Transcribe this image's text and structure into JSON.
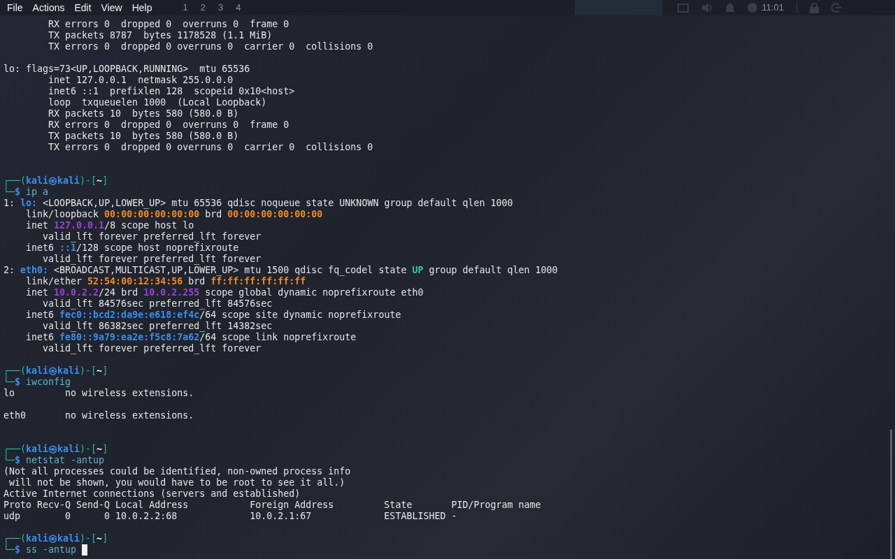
{
  "menu": [
    "File",
    "Actions",
    "Edit",
    "View",
    "Help"
  ],
  "panel": {
    "workspaces": [
      "1",
      "2",
      "3",
      "4"
    ],
    "clock": "11:01"
  },
  "terminal": {
    "blocks": [
      {
        "blank_after": true,
        "lines": [
          "        RX errors 0  dropped 0  overruns 0  frame 0",
          "        TX packets 8787  bytes 1178528 (1.1 MiB)",
          "        TX errors 0  dropped 0 overruns 0  carrier 0  collisions 0"
        ]
      },
      {
        "blank_after": true,
        "double_blank": true,
        "lines": [
          "lo: flags=73<UP,LOOPBACK,RUNNING>  mtu 65536",
          "        inet 127.0.0.1  netmask 255.0.0.0",
          "        inet6 ::1  prefixlen 128  scopeid 0x10<host>",
          "        loop  txqueuelen 1000  (Local Loopback)",
          "        RX packets 10  bytes 580 (580.0 B)",
          "        RX errors 0  dropped 0  overruns 0  frame 0",
          "        TX packets 10  bytes 580 (580.0 B)",
          "        TX errors 0  dropped 0 overruns 0  carrier 0  collisions 0"
        ]
      },
      {
        "blank_after": true,
        "lines": [
          [
            {
              "text": "┌──(",
              "kind": "frame"
            },
            {
              "text": "kali㉿kali",
              "kind": "user"
            },
            {
              "text": ")-[",
              "kind": "frame"
            },
            {
              "text": "~",
              "kind": "dir"
            },
            {
              "text": "]",
              "kind": "frame"
            }
          ],
          [
            {
              "text": "└─",
              "kind": "frame"
            },
            {
              "text": "$",
              "kind": "user"
            },
            {
              "text": " ip a",
              "kind": "cmd"
            }
          ],
          [
            {
              "text": "1: ",
              "kind": "plain"
            },
            {
              "text": "lo:",
              "kind": "iface"
            },
            {
              "text": " <LOOPBACK,UP,LOWER_UP> mtu 65536 qdisc noqueue state UNKNOWN group default qlen 1000",
              "kind": "plain"
            }
          ],
          [
            {
              "text": "    link/loopback ",
              "kind": "plain"
            },
            {
              "text": "00:00:00:00:00:00",
              "kind": "mac"
            },
            {
              "text": " brd ",
              "kind": "plain"
            },
            {
              "text": "00:00:00:00:00:00",
              "kind": "mac"
            }
          ],
          [
            {
              "text": "    inet ",
              "kind": "plain"
            },
            {
              "text": "127.0.0.1",
              "kind": "ip4"
            },
            {
              "text": "/8 scope host lo",
              "kind": "plain"
            }
          ],
          "       valid_lft forever preferred_lft forever",
          [
            {
              "text": "    inet6 ",
              "kind": "plain"
            },
            {
              "text": "::1",
              "kind": "ip6"
            },
            {
              "text": "/128 scope host noprefixroute",
              "kind": "plain"
            }
          ],
          "       valid_lft forever preferred_lft forever",
          [
            {
              "text": "2: ",
              "kind": "plain"
            },
            {
              "text": "eth0:",
              "kind": "iface"
            },
            {
              "text": " <BROADCAST,MULTICAST,UP,LOWER_UP> mtu 1500 qdisc fq_codel state ",
              "kind": "plain"
            },
            {
              "text": "UP",
              "kind": "up"
            },
            {
              "text": " group default qlen 1000",
              "kind": "plain"
            }
          ],
          [
            {
              "text": "    link/ether ",
              "kind": "plain"
            },
            {
              "text": "52:54:00:12:34:56",
              "kind": "mac"
            },
            {
              "text": " brd ",
              "kind": "plain"
            },
            {
              "text": "ff:ff:ff:ff:ff:ff",
              "kind": "mac"
            }
          ],
          [
            {
              "text": "    inet ",
              "kind": "plain"
            },
            {
              "text": "10.0.2.2",
              "kind": "ip4"
            },
            {
              "text": "/24 brd ",
              "kind": "plain"
            },
            {
              "text": "10.0.2.255",
              "kind": "ip4"
            },
            {
              "text": " scope global dynamic noprefixroute eth0",
              "kind": "plain"
            }
          ],
          "       valid_lft 84576sec preferred_lft 84576sec",
          [
            {
              "text": "    inet6 ",
              "kind": "plain"
            },
            {
              "text": "fec0::bcd2:da9e:e618:ef4c",
              "kind": "ip6"
            },
            {
              "text": "/64 scope site dynamic noprefixroute",
              "kind": "plain"
            }
          ],
          "       valid_lft 86382sec preferred_lft 14382sec",
          [
            {
              "text": "    inet6 ",
              "kind": "plain"
            },
            {
              "text": "fe80::9a79:ea2e:f5c8:7a62",
              "kind": "ip6"
            },
            {
              "text": "/64 scope link noprefixroute",
              "kind": "plain"
            }
          ],
          "       valid_lft forever preferred_lft forever"
        ]
      },
      {
        "blank_after": true,
        "lines": [
          [
            {
              "text": "┌──(",
              "kind": "frame"
            },
            {
              "text": "kali㉿kali",
              "kind": "user"
            },
            {
              "text": ")-[",
              "kind": "frame"
            },
            {
              "text": "~",
              "kind": "dir"
            },
            {
              "text": "]",
              "kind": "frame"
            }
          ],
          [
            {
              "text": "└─",
              "kind": "frame"
            },
            {
              "text": "$",
              "kind": "user"
            },
            {
              "text": " iwconfig",
              "kind": "cmd"
            }
          ],
          "lo         no wireless extensions."
        ]
      },
      {
        "blank_after": true,
        "double_blank": true,
        "lines": [
          "eth0       no wireless extensions."
        ]
      },
      {
        "blank_after": true,
        "lines": [
          [
            {
              "text": "┌──(",
              "kind": "frame"
            },
            {
              "text": "kali㉿kali",
              "kind": "user"
            },
            {
              "text": ")-[",
              "kind": "frame"
            },
            {
              "text": "~",
              "kind": "dir"
            },
            {
              "text": "]",
              "kind": "frame"
            }
          ],
          [
            {
              "text": "└─",
              "kind": "frame"
            },
            {
              "text": "$",
              "kind": "user"
            },
            {
              "text": " netstat -antup",
              "kind": "cmd"
            }
          ],
          "(Not all processes could be identified, non-owned process info",
          " will not be shown, you would have to be root to see it all.)",
          "Active Internet connections (servers and established)",
          "Proto Recv-Q Send-Q Local Address           Foreign Address         State       PID/Program name",
          "udp        0      0 10.0.2.2:68             10.0.2.1:67             ESTABLISHED -"
        ]
      },
      {
        "lines": [
          [
            {
              "text": "┌──(",
              "kind": "frame"
            },
            {
              "text": "kali㉿kali",
              "kind": "user"
            },
            {
              "text": ")-[",
              "kind": "frame"
            },
            {
              "text": "~",
              "kind": "dir"
            },
            {
              "text": "]",
              "kind": "frame"
            }
          ],
          [
            {
              "text": "└─",
              "kind": "frame"
            },
            {
              "text": "$",
              "kind": "user"
            },
            {
              "text": " ss -antup ",
              "kind": "cmd"
            },
            {
              "kind": "cursor"
            }
          ]
        ]
      }
    ]
  }
}
